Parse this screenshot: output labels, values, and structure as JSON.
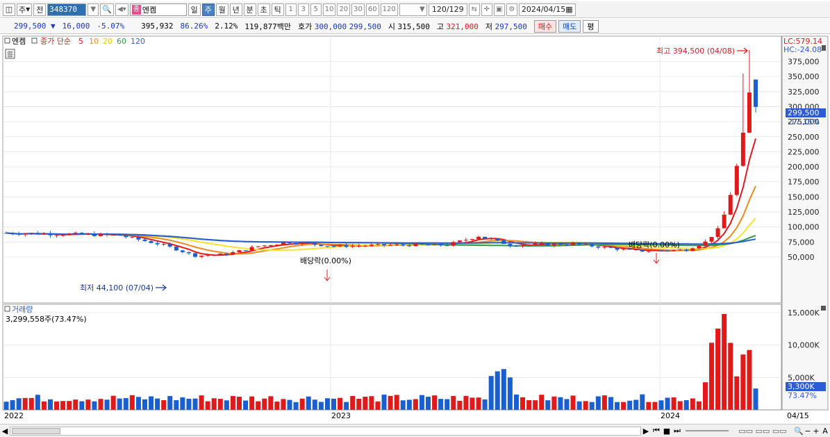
{
  "toolbar": {
    "period_selector": "주",
    "prev_label": "전",
    "stock_code": "348370",
    "stock_badge": "종",
    "stock_name": "엔켐",
    "periods": [
      "일",
      "주",
      "월",
      "년",
      "분",
      "초",
      "틱"
    ],
    "selected_period": "주",
    "intervals": [
      "1",
      "3",
      "5",
      "10",
      "20",
      "30",
      "60",
      "120"
    ],
    "count": "120",
    "count_total": "/129",
    "date": "2024/04/15"
  },
  "quote": {
    "price": "299,500",
    "change": "16,000",
    "change_pct": "-5.07%",
    "volume": "395,932",
    "volume_ratio": "86.26%",
    "turnover": "2.12%",
    "amount": "119,877백만",
    "bid_label": "호가",
    "bid": "300,000",
    "ask": "299,500",
    "open_label": "시",
    "open": "315,500",
    "high_label": "고",
    "high": "321,000",
    "low_label": "저",
    "low": "297,500",
    "buy_label": "매수",
    "sell_label": "매도",
    "eval_label": "평"
  },
  "price_panel": {
    "title": "엔켐",
    "legend_prefix": "종가 단순",
    "ma_labels": [
      "5",
      "10",
      "20",
      "60",
      "120"
    ],
    "ma_colors": [
      "#e0191b",
      "#f08a1c",
      "#f6e32a",
      "#2e9a44",
      "#2b5cd6"
    ],
    "lc_label": "LC:579.14",
    "hc_label": "HC:-24.08",
    "last_price": "299,500",
    "last_change": "-17.15%",
    "high_annot": "최고 394,500 (04/08)",
    "low_annot": "최저 44,100 (07/04)",
    "dividend_annot": "배당락(0.00%)",
    "y_ticks": [
      "375,000",
      "350,000",
      "325,000",
      "300,000",
      "275,000",
      "250,000",
      "225,000",
      "200,000",
      "175,000",
      "150,000",
      "125,000",
      "100,000",
      "75,000",
      "50,000"
    ]
  },
  "volume_panel": {
    "title": "거래량",
    "summary": "3,299,558주(73.47%)",
    "y_ticks": [
      "15,000K",
      "10,000K",
      "5,000K"
    ],
    "last_volume": "3,300K",
    "last_ratio": "73.47%"
  },
  "x_axis": {
    "labels": [
      "2022",
      "2023",
      "2024"
    ],
    "end_label": "04/15"
  },
  "chart_data": {
    "type": "candlestick",
    "title": "엔켐",
    "ylim": [
      30000,
      400000
    ],
    "volume_ylim": [
      0,
      15000
    ],
    "x_labels": [
      "2022",
      "2023",
      "2024"
    ],
    "series": [
      {
        "name": "5",
        "type": "line"
      },
      {
        "name": "10",
        "type": "line"
      },
      {
        "name": "20",
        "type": "line"
      },
      {
        "name": "60",
        "type": "line"
      },
      {
        "name": "120",
        "type": "line"
      },
      {
        "name": "거래량",
        "type": "bar"
      }
    ],
    "high": {
      "value": 394500,
      "date": "04/08"
    },
    "low": {
      "value": 44100,
      "date": "07/04"
    },
    "last": {
      "close": 299500,
      "volume_k": 3300
    }
  }
}
